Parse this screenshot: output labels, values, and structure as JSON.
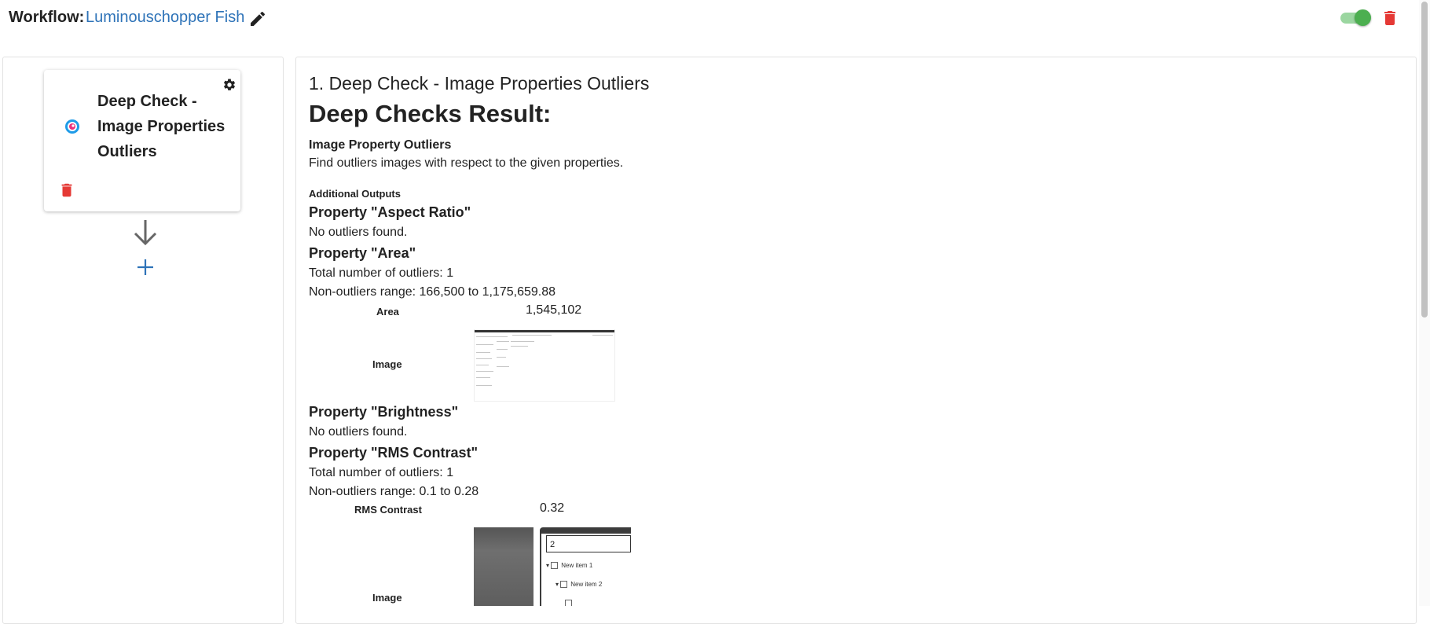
{
  "header": {
    "workflow_label": "Workflow:",
    "workflow_name": "Luminouschopper Fish",
    "icons": {
      "edit": "pencil-icon",
      "delete": "trash-icon"
    },
    "toggle_on": true
  },
  "pipeline": {
    "step_card": {
      "title": "Deep Check - Image Properties Outliers",
      "icons": {
        "settings": "gear-icon",
        "logo": "deepchecks-logo-icon",
        "delete": "trash-icon"
      }
    },
    "connector_icon": "arrow-down-icon",
    "add_icon": "plus-icon"
  },
  "result": {
    "step_heading": "1. Deep Check - Image Properties Outliers",
    "title": "Deep Checks Result:",
    "check_name": "Image Property Outliers",
    "check_description": "Find outliers images with respect to the given properties.",
    "additional_outputs_label": "Additional Outputs",
    "properties": [
      {
        "heading": "Property \"Aspect Ratio\"",
        "lines": [
          "No outliers found."
        ]
      },
      {
        "heading": "Property \"Area\"",
        "lines": [
          "Total number of outliers: 1",
          "Non-outliers range: 166,500 to 1,175,659.88"
        ],
        "table": {
          "row_label": "Area",
          "value": "1,545,102",
          "image_label": "Image"
        }
      },
      {
        "heading": "Property \"Brightness\"",
        "lines": [
          "No outliers found."
        ]
      },
      {
        "heading": "Property \"RMS Contrast\"",
        "lines": [
          "Total number of outliers: 1",
          "Non-outliers range: 0.1 to 0.28"
        ],
        "table": {
          "row_label": "RMS Contrast",
          "value": "0.32",
          "image_label": "Image",
          "thumbnail_text": {
            "input": "2",
            "item1": "New item 1",
            "item2": "New item 2"
          }
        }
      }
    ]
  },
  "colors": {
    "accent_blue": "#2e73b8",
    "danger_red": "#e53935",
    "toggle_green": "#4caf50"
  }
}
